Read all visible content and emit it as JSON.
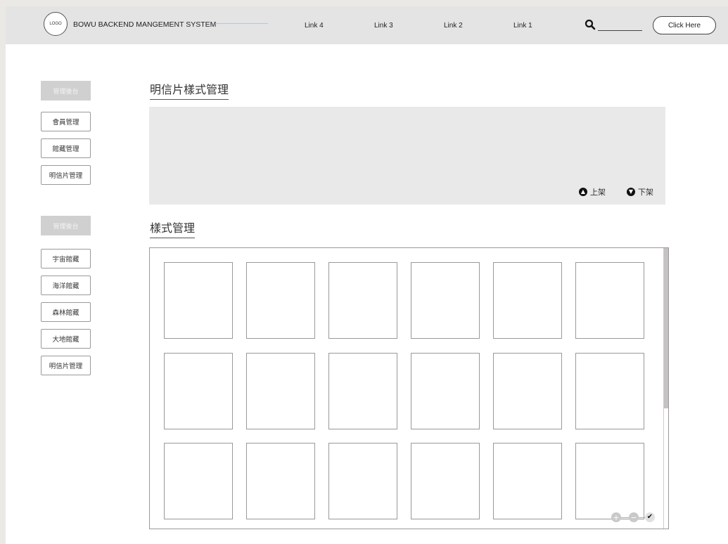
{
  "header": {
    "logo_text": "LOGO",
    "system_title": "BOWU BACKEND MANGEMENT SYSTEM",
    "nav_links": [
      "Link 4",
      "Link 3",
      "Link 2",
      "Link 1"
    ],
    "search_value": "",
    "search_placeholder": "",
    "cta_label": "Click Here"
  },
  "sidebar": {
    "group1": {
      "header": "管理後台",
      "items": [
        "會員管理",
        "館藏管理",
        "明信片管理"
      ]
    },
    "group2": {
      "header": "管理後台",
      "items": [
        "宇宙館藏",
        "海洋館藏",
        "森林館藏",
        "大地館藏",
        "明信片管理"
      ]
    }
  },
  "main": {
    "section1_title": "明信片樣式管理",
    "publish_label": "上架",
    "unpublish_label": "下架",
    "section2_title": "樣式管理",
    "grid": {
      "rows": 3,
      "columns": 6
    }
  },
  "colors": {
    "header_bg": "#e4e4e4",
    "panel_bg": "#e9e9e9",
    "sidebar_header_bg": "#d0d0d0",
    "scroll_thumb": "#c7c2c2"
  },
  "icons": {
    "search": "search-icon",
    "publish": "arrow-up-circle-icon",
    "unpublish": "arrow-down-circle-icon",
    "zoom_in": "plus-circle-icon",
    "zoom_out": "minus-circle-icon",
    "confirm": "check-circle-icon"
  }
}
